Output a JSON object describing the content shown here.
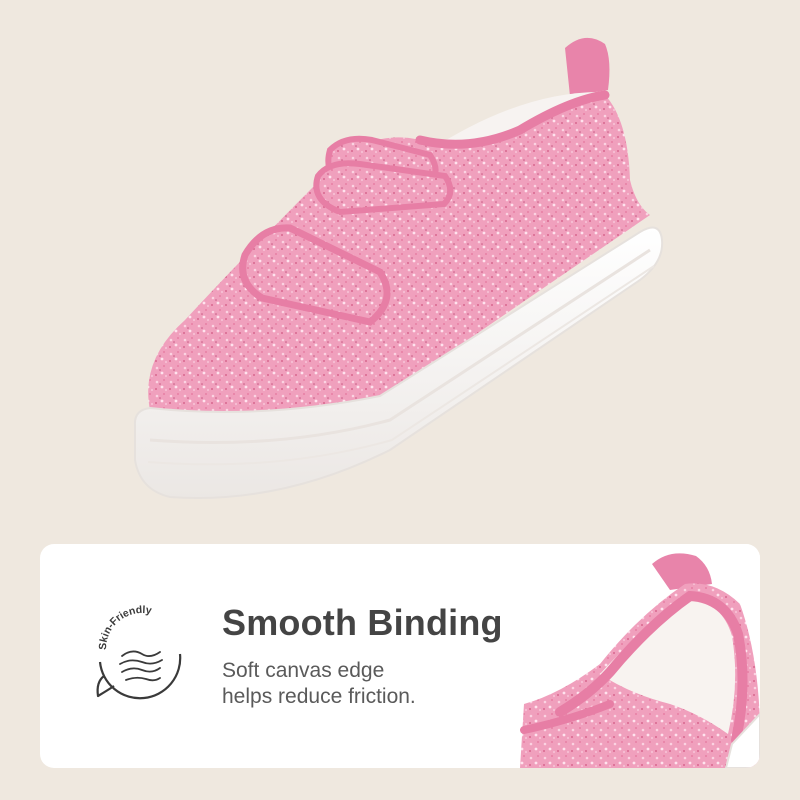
{
  "colors": {
    "background": "#efe8df",
    "card": "#ffffff",
    "glitter_pink": "#f2a3bf",
    "binding_pink": "#e77ea5",
    "sole_white": "#ffffff",
    "title_text": "#444444",
    "body_text": "#5a5a5a"
  },
  "hero": {
    "image": "pink-glitter-sneaker-photo"
  },
  "feature": {
    "badge_text": "Skin-Friendly",
    "badge_icon": "wave-skin-icon",
    "title": "Smooth Binding",
    "description_line1": "Soft canvas edge",
    "description_line2": "helps reduce friction.",
    "detail_image": "heel-collar-closeup-photo"
  }
}
